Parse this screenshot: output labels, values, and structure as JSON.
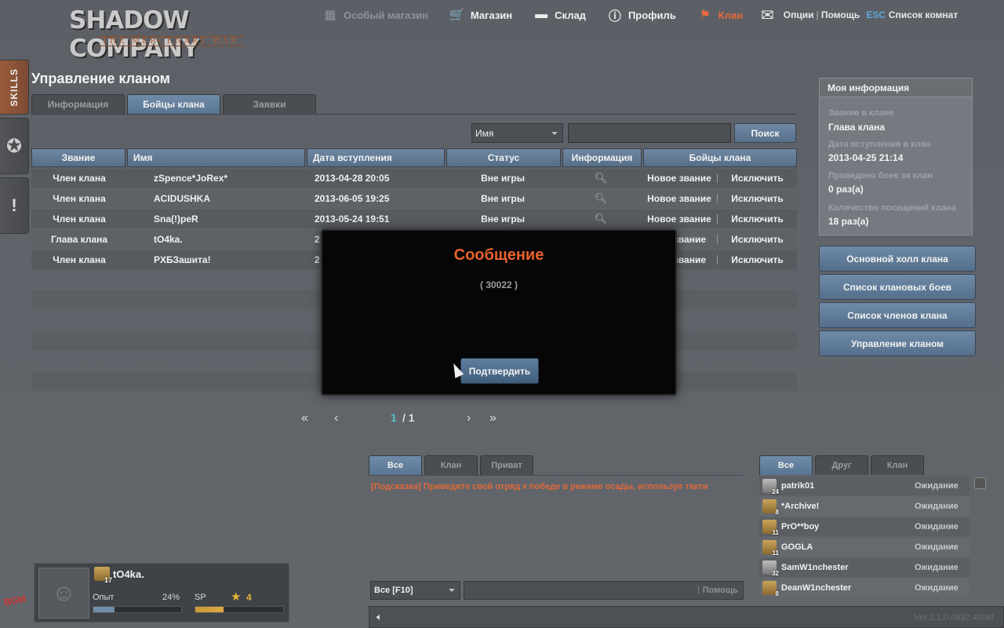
{
  "logo": {
    "title": "SHADOW COMPANY",
    "subtitle": "THE MERCENARY WAR"
  },
  "topnav": [
    {
      "label": "Особый магазин",
      "icon": "grid-icon",
      "state": "disabled"
    },
    {
      "label": "Магазин",
      "icon": "cart-icon",
      "state": "normal"
    },
    {
      "label": "Склад",
      "icon": "gun-icon",
      "state": "normal"
    },
    {
      "label": "Профиль",
      "icon": "info-icon",
      "state": "normal"
    },
    {
      "label": "Клан",
      "icon": "flag-icon",
      "state": "active"
    }
  ],
  "topright": {
    "options": "Опции",
    "help": "Помощь",
    "esc": "ESC",
    "rooms": "Список комнат"
  },
  "sidetabs": {
    "skills": "SKILLS"
  },
  "page_title": "Управление кланом",
  "tabs": [
    {
      "label": "Информация",
      "active": false
    },
    {
      "label": "Бойцы клана",
      "active": true
    },
    {
      "label": "Заявки",
      "active": false
    }
  ],
  "search": {
    "field_select": "Имя",
    "input_value": "",
    "button": "Поиск"
  },
  "table": {
    "columns": [
      "Звание",
      "Имя",
      "Дата вступления",
      "Статус",
      "Информация",
      "Бойцы клана"
    ],
    "rows": [
      {
        "rank": "Член клана",
        "name": "zSpence*JoRex*",
        "date": "2013-04-28 20:05",
        "status": "Вне игры",
        "action1": "Новое звание",
        "action2": "Исключить"
      },
      {
        "rank": "Член клана",
        "name": "ACIDUSHKA",
        "date": "2013-06-05 19:25",
        "status": "Вне игры",
        "action1": "Новое звание",
        "action2": "Исключить"
      },
      {
        "rank": "Член клана",
        "name": "Sna(!)peR",
        "date": "2013-05-24 19:51",
        "status": "Вне игры",
        "action1": "Новое звание",
        "action2": "Исключить"
      },
      {
        "rank": "Глава клана",
        "name": "tO4ka.",
        "date": "2",
        "status": "",
        "action1": "звание",
        "action2": "Исключить"
      },
      {
        "rank": "Член клана",
        "name": "PXБЗашита!",
        "date": "2",
        "status": "",
        "action1": "звание",
        "action2": "Исключить"
      }
    ]
  },
  "pager": {
    "first": "«",
    "prev": "‹",
    "current": "1",
    "total": "/ 1",
    "next": "›",
    "last": "»"
  },
  "modal": {
    "title": "Сообщение",
    "text": "( 30022 )",
    "confirm": "Подтвердить"
  },
  "info": {
    "header": "Моя информация",
    "rank_label": "Звание в клане",
    "rank_value": "Глава клана",
    "join_label": "Дата вступления в клан",
    "join_value": "2013-04-25 21:14",
    "battles_label": "Проведено боев за клан",
    "battles_value": "0 раз(а)",
    "visits_label": "Количество посещений клана",
    "visits_value": "18 раз(а)"
  },
  "right_buttons": [
    "Основной холл клана",
    "Список клановых боев",
    "Список членов клана",
    "Управление кланом"
  ],
  "chat": {
    "tabs": [
      {
        "label": "Все",
        "active": true
      },
      {
        "label": "Клан",
        "active": false
      },
      {
        "label": "Приват",
        "active": false
      }
    ],
    "message": "[Подсказка] Приведите свой отряд к победе в режиме осады, используя такти",
    "channel": "Все [F10]",
    "input_value": "",
    "help": "Помощь"
  },
  "friends": {
    "tabs": [
      {
        "label": "Все",
        "active": true
      },
      {
        "label": "Друг",
        "active": false
      },
      {
        "label": "Клан",
        "active": false
      }
    ],
    "list": [
      {
        "level": "24",
        "name": "patrik01",
        "status": "Ожидание"
      },
      {
        "level": "8",
        "name": "*Archive!",
        "status": "Ожидание"
      },
      {
        "level": "11",
        "name": "PrO**boy",
        "status": "Ожидание"
      },
      {
        "level": "11",
        "name": "GOGLA",
        "status": "Ожидание"
      },
      {
        "level": "32",
        "name": "SamW1nchester",
        "status": "Ожидание"
      },
      {
        "level": "8",
        "name": "DeanW1nchester",
        "status": "Ожидание"
      }
    ]
  },
  "player": {
    "level": "17",
    "name": "tO4ka.",
    "exp_label": "Опыт",
    "exp_pct": "24%",
    "exp_fraction": 0.24,
    "sp_label": "SP",
    "sp_value": "4",
    "sp_fraction": 0.32
  },
  "bottom": {
    "version": "Ver.2.1.0.0832.400M"
  },
  "colors": {
    "accent": "#e8693a",
    "button": "#6f8ba8",
    "modal_title": "#e8622c",
    "pager_current": "#4fc3c3"
  }
}
